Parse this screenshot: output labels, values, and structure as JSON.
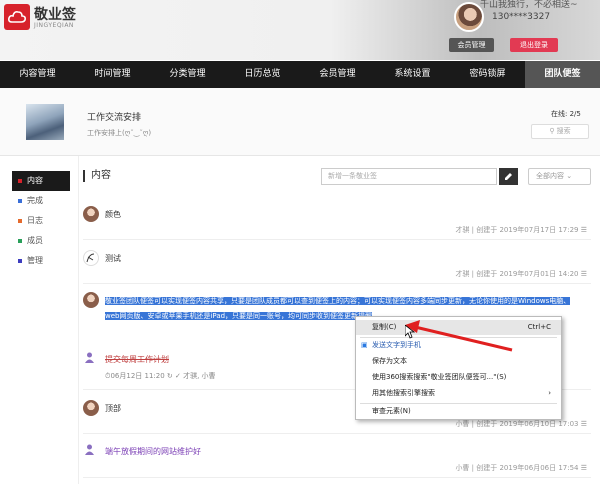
{
  "header": {
    "app_name": "敬业签",
    "app_sub": "JINGYEQIAN",
    "slogan": "千山我独行，不必相送~",
    "phone": "130****3327",
    "vip_label": "会员管理",
    "logout_label": "退出登录"
  },
  "nav": {
    "items": [
      "内容管理",
      "时间管理",
      "分类管理",
      "日历总览",
      "会员管理",
      "系统设置",
      "密码锁屏",
      "团队便签"
    ]
  },
  "group": {
    "title": "工作交流安排",
    "desc": "工作安排上(ღ˘‿˘ღ)",
    "online_label": "在线: 2/5",
    "search_label": "搜索"
  },
  "sidebar": {
    "items": [
      {
        "label": "内容",
        "color": "#d7222b"
      },
      {
        "label": "完成",
        "color": "#3a6fd8"
      },
      {
        "label": "日志",
        "color": "#e56b2e"
      },
      {
        "label": "成员",
        "color": "#2aa05a"
      },
      {
        "label": "管理",
        "color": "#3d3dbf"
      }
    ]
  },
  "main": {
    "section_title": "内容",
    "new_placeholder": "新增一条敬业签",
    "filter_label": "全部内容",
    "notes": [
      {
        "text": "颜色",
        "meta": "才骐 | 创建于 2019年07月17日 17:29 ☰"
      },
      {
        "text": "测试",
        "meta": "才骐 | 创建于 2019年07月01日 14:20 ☰"
      },
      {
        "text_line1": "敬业签团队便签可以实现便签内容共享，只要是团队成员都可以查到便签上的内容；可以实现便签内容多端同步更新，无论你使用的是Windows电脑、",
        "text_line2": "web网页版、安卓或苹果手机还是iPad，只要是同一账号，均可同步收到便签更新提醒"
      },
      {
        "text": "提交每周工作计划",
        "sub": "⏱06月12日 11:20  ↻  ✓ 才骐, 小曹"
      },
      {
        "text": "顶部",
        "meta": "小曹 | 创建于 2019年06月10日 17:03 ☰"
      },
      {
        "text": "端午放假期间的网站维护好",
        "meta": "小曹 | 创建于 2019年06月06日 17:54 ☰"
      }
    ]
  },
  "context_menu": {
    "copy": "复制(C)",
    "copy_shortcut": "Ctrl+C",
    "send_phone": "发送文字到手机",
    "save_text": "保存为文本",
    "search_360": "使用360搜索搜索\"敬业签团队便签可...\"(S)",
    "search_other": "用其他搜索引擎搜索",
    "inspect": "审查元素(N)"
  }
}
